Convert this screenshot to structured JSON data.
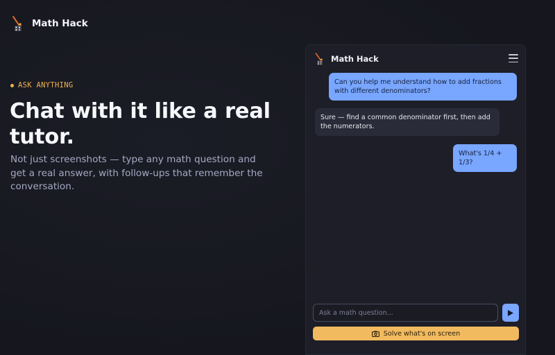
{
  "brand": {
    "name": "Math Hack",
    "icon": "calculator-brush-logo"
  },
  "hero": {
    "eyebrow": "ASK ANYTHING",
    "title": "Chat with it like a real tutor.",
    "subtitle": "Not just screenshots — type any math question and get a real answer, with follow-ups that remember the conversation."
  },
  "chat": {
    "title": "Math Hack",
    "menu_icon": "hamburger-menu-icon",
    "messages": [
      {
        "role": "user",
        "text": "Can you help me understand how to add fractions with different denominators?"
      },
      {
        "role": "assistant",
        "text": "Sure — find a common denominator first, then add the numerators."
      },
      {
        "role": "user",
        "text": "What's 1/4 + 1/3?"
      }
    ],
    "input": {
      "placeholder": "Ask a math question...",
      "value": ""
    },
    "send_icon": "send-arrow-icon",
    "solve_label": "Solve what's on screen",
    "solve_icon": "camera-icon"
  },
  "colors": {
    "accent_orange": "#f2ba5f",
    "accent_blue": "#79a6ff",
    "background": "#16171e",
    "panel": "#1d1e27"
  }
}
